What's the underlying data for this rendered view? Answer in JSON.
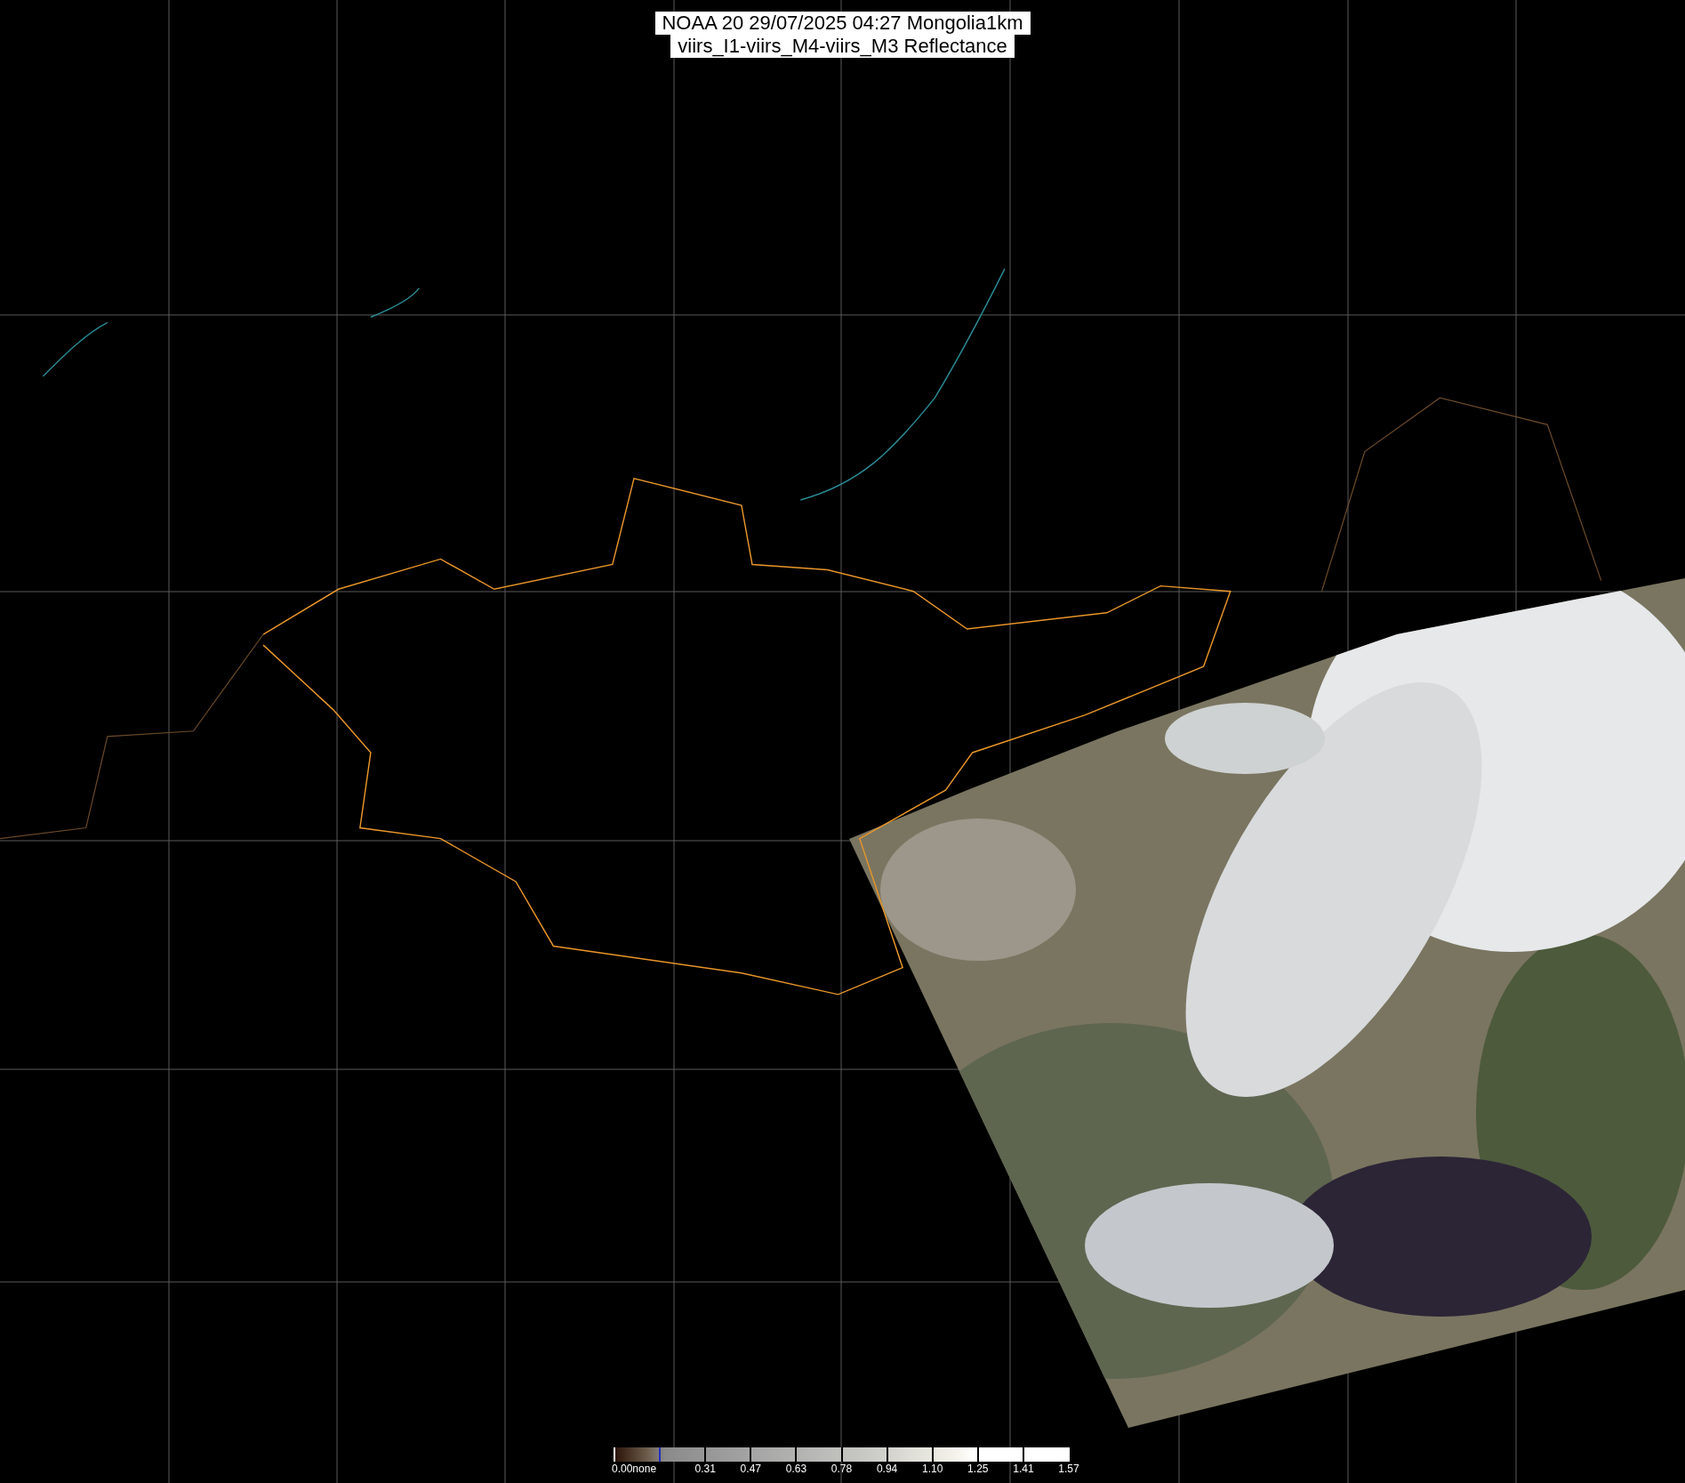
{
  "title": {
    "lines": [
      "NOAA 20 29/07/2025 04:27 Mongolia1km",
      "viirs_I1-viirs_M4-viirs_M3 Reflectance"
    ]
  },
  "colorbar": {
    "labels": [
      "0.00none",
      "0.31",
      "0.47",
      "0.63",
      "0.78",
      "0.94",
      "1.10",
      "1.25",
      "1.41",
      "1.57"
    ]
  }
}
